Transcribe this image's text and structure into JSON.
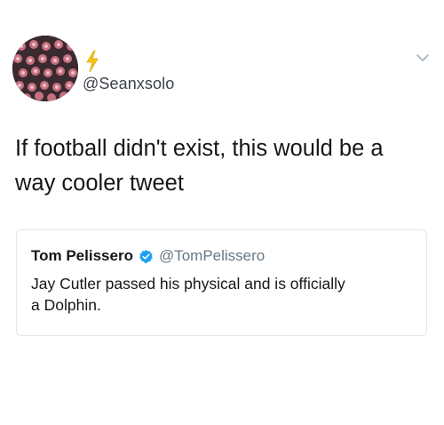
{
  "tweet": {
    "handle": "@Seanxsolo",
    "text_line1": "If football didn't exist, this would be a",
    "text_line2": "way cooler tweet",
    "avatar_icon": "profile-avatar",
    "flair_icon": "lightning-bolt-icon",
    "menu_icon": "chevron-down-icon"
  },
  "quoted_tweet": {
    "name": "Tom Pelissero",
    "handle": "@TomPelissero",
    "text_line1": "Jay Cutler passed his physical and is officially",
    "text_line2": "a Dolphin.",
    "verified_icon": "verified-badge-icon"
  },
  "colors": {
    "text_primary": "#14171a",
    "text_secondary": "#657786",
    "verified_blue": "#1da1f2",
    "bolt_yellow": "#f5c518",
    "card_border": "#e1e8ed"
  }
}
